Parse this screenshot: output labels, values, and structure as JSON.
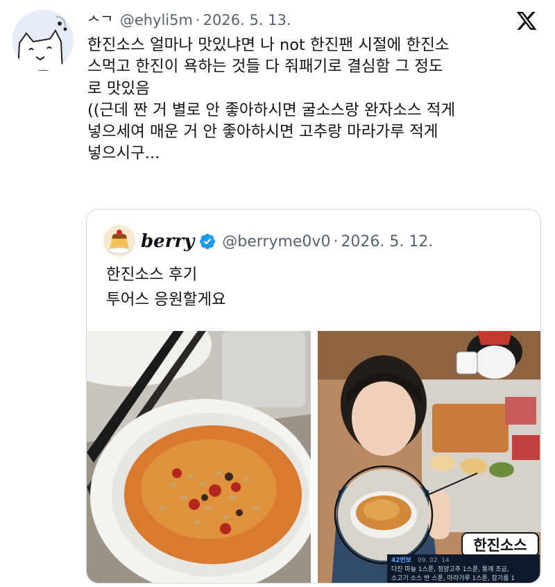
{
  "tweet": {
    "display_name": "ᄉᄀ",
    "handle": "@ehyli5m",
    "separator": "·",
    "date": "2026. 5. 13.",
    "lines": [
      "한진소스 얼마나 맛있냐면 나 not 한진팬 시절에 한진소",
      "스먹고 한진이 욕하는 것들 다 줘패기로 결심함 그 정도",
      "로 맛있음",
      "((근데 짠 거 별로 안 좋아하시면 굴소스랑 완자소스 적게",
      "넣으세여 매운 거 안 좋아하시면 고추랑 마라가루 적게",
      "넣으시구..."
    ]
  },
  "quote": {
    "display_name": "berry",
    "handle": "@berryme0v0",
    "separator": "·",
    "date": "2026. 5. 12.",
    "lines": [
      "한진소스 후기",
      "투어스 응원할게요"
    ],
    "photo2": {
      "sticker": "한진소스",
      "table_number": "42",
      "stub_user": "42번보",
      "stub_date": "09. 02. 14",
      "stub_lines": [
        "다진 마늘 1스푼, 청양고추 1스푼, 통깨 조금,",
        "소고기 소스 반 스푼, 마라가루 1스푼, 참기름 1"
      ]
    }
  },
  "colors": {
    "text": "#0f1419",
    "muted": "#536471",
    "border": "#cfd9de",
    "verified": "#1d9bf0"
  },
  "icons": {
    "logo": "x-logo-icon",
    "verified": "verified-badge-icon"
  }
}
